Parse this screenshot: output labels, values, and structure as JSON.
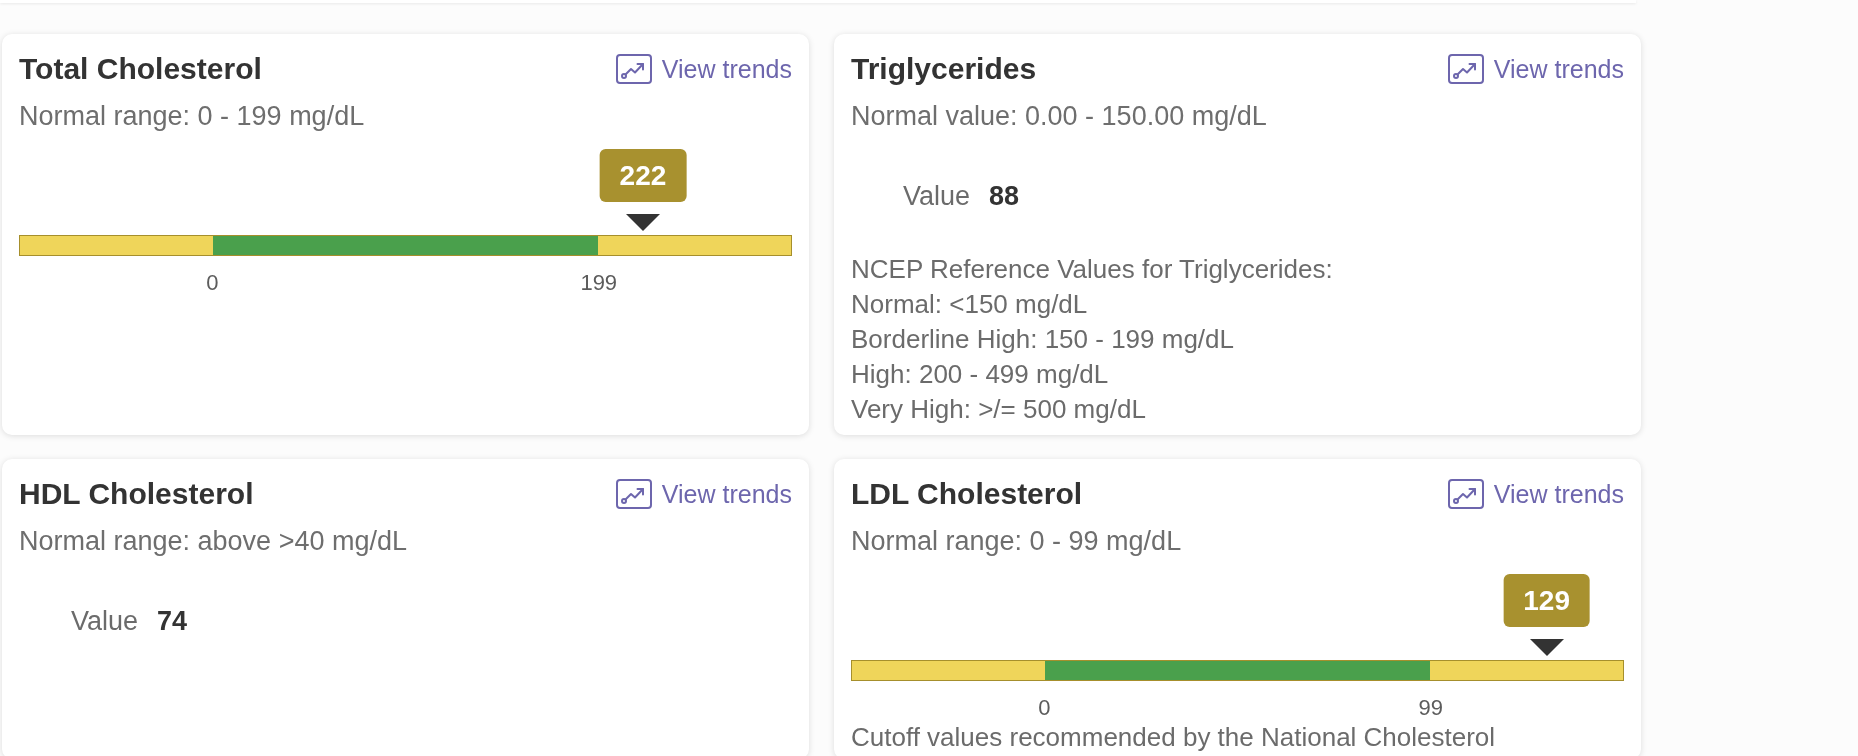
{
  "cards": [
    {
      "kind": "gauge",
      "title": "Total Cholesterol",
      "trend_link": "View trends",
      "range_text": "Normal range: 0 - 199 mg/dL",
      "gauge": {
        "value": "222",
        "level": 0.808,
        "low_label": "0",
        "high_label": "199"
      }
    },
    {
      "kind": "value",
      "title": "Triglycerides",
      "trend_link": "View trends",
      "range_text": "Normal value: 0.00 - 150.00 mg/dL",
      "value_label": "Value",
      "value": "88",
      "notes": [
        "NCEP Reference Values for Triglycerides:",
        "Normal: <150 mg/dL",
        "Borderline High: 150 - 199 mg/dL",
        "High: 200 - 499 mg/dL",
        "Very High: >/= 500 mg/dL"
      ]
    },
    {
      "kind": "value",
      "title": "HDL Cholesterol",
      "trend_link": "View trends",
      "range_text": "Normal range: above >40 mg/dL",
      "value_label": "Value",
      "value": "74"
    },
    {
      "kind": "gauge",
      "title": "LDL Cholesterol",
      "trend_link": "View trends",
      "range_text": "Normal range: 0 - 99 mg/dL",
      "gauge": {
        "value": "129",
        "level": 0.901,
        "low_label": "0",
        "high_label": "99"
      },
      "notes": [
        "Cutoff values recommended by the National Cholesterol"
      ]
    }
  ]
}
